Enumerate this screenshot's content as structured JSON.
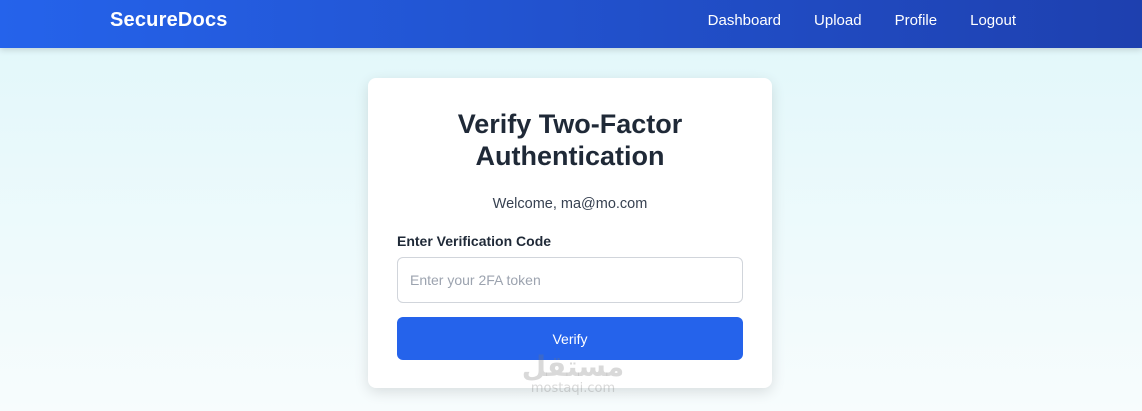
{
  "navbar": {
    "brand": "SecureDocs",
    "links": [
      {
        "label": "Dashboard"
      },
      {
        "label": "Upload"
      },
      {
        "label": "Profile"
      },
      {
        "label": "Logout"
      }
    ]
  },
  "card": {
    "title": "Verify Two-Factor Authentication",
    "welcome": "Welcome, ma@mo.com",
    "field_label": "Enter Verification Code",
    "input_value": "",
    "input_placeholder": "Enter your 2FA token",
    "verify_label": "Verify"
  },
  "watermark": {
    "arabic": "مستقل",
    "latin": "mostaqi.com"
  },
  "colors": {
    "nav_start": "#2563eb",
    "nav_end": "#1e40af",
    "button": "#2563eb",
    "background_top": "#e0f7fa"
  }
}
